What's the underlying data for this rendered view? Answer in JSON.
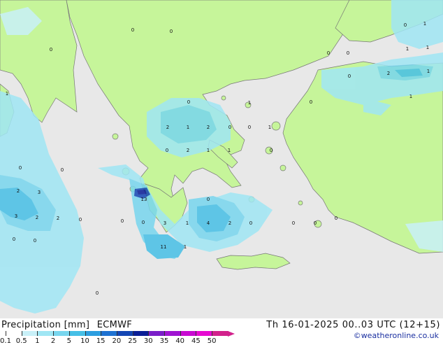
{
  "header": {
    "product": "Precipitation [mm]",
    "model": "ECMWF",
    "datetime": "Th 16-01-2025 00..03 UTC (12+15)"
  },
  "credit": "©weatheronline.co.uk",
  "legend": {
    "ticks": [
      "0.1",
      "0.5",
      "1",
      "2",
      "5",
      "10",
      "15",
      "20",
      "25",
      "30",
      "35",
      "40",
      "45",
      "50"
    ],
    "colors": [
      "#ffffff",
      "#c8f0f8",
      "#a0e6f4",
      "#78d6ee",
      "#46bfe6",
      "#2c9ee0",
      "#1e72d2",
      "#1446b4",
      "#0a1e96",
      "#7a1ec8",
      "#a014d2",
      "#c80ad2",
      "#e60ad2",
      "#d2228c"
    ]
  },
  "map": {
    "land_color": "#c6f59a",
    "sea_color": "#e8e8e8",
    "values": [
      "0",
      "0",
      "0",
      "0",
      "0",
      "1",
      "1",
      "1",
      "2",
      "0",
      "1",
      "1",
      "0",
      "1",
      "2",
      "1",
      "2",
      "0",
      "0",
      "1",
      "0",
      "2",
      "1",
      "1",
      "0",
      "1",
      "0",
      "0",
      "3",
      "13",
      "2",
      "3",
      "2",
      "2",
      "0",
      "0",
      "0",
      "3",
      "1",
      "4",
      "2",
      "0",
      "0",
      "0",
      "0",
      "0",
      "11",
      "1",
      "0",
      "0",
      "0",
      "0",
      "0"
    ]
  }
}
